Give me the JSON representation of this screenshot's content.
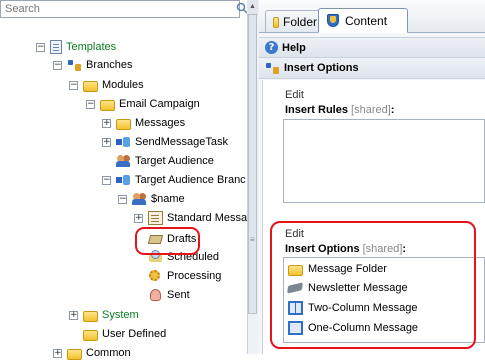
{
  "search": {
    "placeholder": "Search"
  },
  "tree": [
    {
      "label": "Templates",
      "color": "#0b7d22"
    },
    {
      "label": "Branches"
    },
    {
      "label": "Modules"
    },
    {
      "label": "Email Campaign"
    },
    {
      "label": "Messages"
    },
    {
      "label": "SendMessageTask"
    },
    {
      "label": "Target Audience"
    },
    {
      "label": "Target Audience Branc"
    },
    {
      "label": "$name"
    },
    {
      "label": "Standard Messa"
    },
    {
      "label": "Drafts"
    },
    {
      "label": "Scheduled"
    },
    {
      "label": "Processing"
    },
    {
      "label": "Sent"
    },
    {
      "label": "System",
      "color": "#0b7d22"
    },
    {
      "label": "User Defined"
    },
    {
      "label": "Common"
    }
  ],
  "tabs": {
    "folder": "Folder",
    "content": "Content"
  },
  "sections": {
    "help": "Help",
    "insert_options": "Insert Options"
  },
  "insert_rules": {
    "edit": "Edit",
    "label": "Insert Rules",
    "shared": "[shared]",
    "colon": ":"
  },
  "insert_options_field": {
    "edit": "Edit",
    "label": "Insert Options",
    "shared": "[shared]",
    "colon": ":"
  },
  "insert_options_items": [
    "Message Folder",
    "Newsletter Message",
    "Two-Column Message",
    "One-Column Message"
  ],
  "annotation_color": "#e3141b"
}
